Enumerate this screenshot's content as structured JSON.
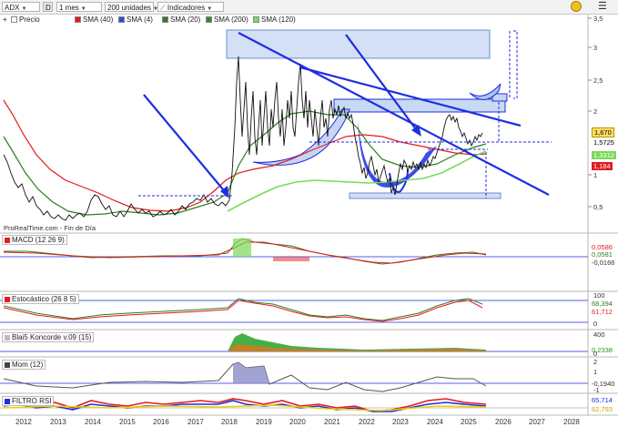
{
  "toolbar": {
    "symbol": "ADX",
    "exchange_badge": "D",
    "period": "1 mes",
    "units": "200 unidades",
    "indicators_label": "Indicadores"
  },
  "legend": [
    {
      "label": "Precio",
      "color": "#111111"
    },
    {
      "label": "SMA (40)",
      "color": "#e41a1c"
    },
    {
      "label": "SMA (4)",
      "color": "#2255cc"
    },
    {
      "label": "SMA (20)",
      "color": "#2e7d1f"
    },
    {
      "label": "SMA (200)",
      "color": "#2d8a2d"
    },
    {
      "label": "SMA (120)",
      "color": "#7cd95a"
    }
  ],
  "price_axis": [
    "3,5",
    "3",
    "2,5",
    "2",
    "1",
    "0,5"
  ],
  "price_tags": {
    "last": "1,670",
    "level": "1,5725",
    "sma_green": "1,3312",
    "sma_red": "1,184"
  },
  "source": "ProRealTime.com - Fin de Día",
  "panels": {
    "macd": {
      "title": "MACD (12 26 9)",
      "axis": [
        "0,0586",
        "0,0581",
        "-0,0166"
      ]
    },
    "stoch": {
      "title": "Estocástico (26 8 5)",
      "axis": [
        "100",
        "68,394",
        "61,712",
        "0"
      ]
    },
    "blai": {
      "title": "Blai5 Koncorde v.09 (15)",
      "axis": [
        "400",
        "0,2338",
        "0"
      ]
    },
    "mom": {
      "title": "Mom (12)",
      "axis": [
        "2",
        "1",
        "-0,1940",
        "-1"
      ]
    },
    "rsi": {
      "title": "FILTRO RSI",
      "axis": [
        "65,714",
        "62,793"
      ]
    }
  },
  "years": [
    "2012",
    "2013",
    "2014",
    "2015",
    "2016",
    "2017",
    "2018",
    "2019",
    "2020",
    "2021",
    "2022",
    "2023",
    "2024",
    "2025",
    "2026",
    "2027",
    "2028"
  ],
  "colors": {
    "background": "#ffffff",
    "price": "#111111",
    "sma40": "#e41a1c",
    "sma20": "#2e7d1f",
    "sma200": "#7cd95a",
    "trendlines": "#1f2ee0",
    "zone": "#c5d6f2"
  }
}
